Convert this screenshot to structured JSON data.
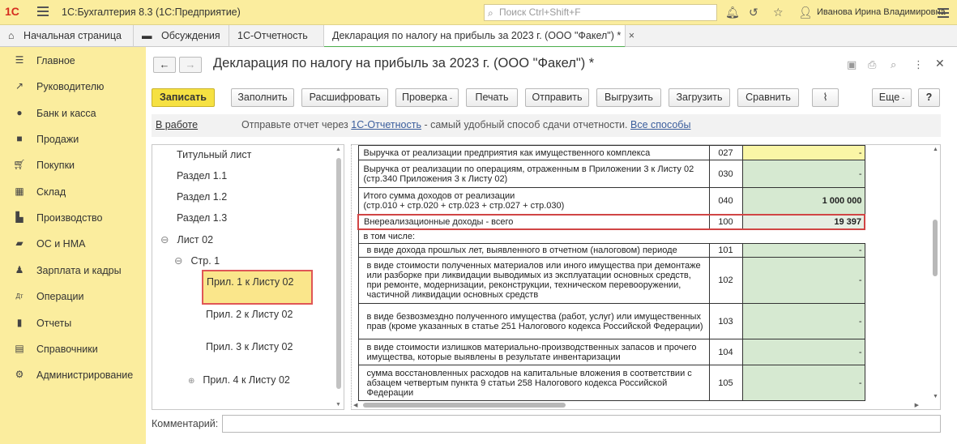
{
  "app": {
    "logo": "1С",
    "title": "1С:Бухгалтерия 8.3  (1С:Предприятие)",
    "search_placeholder": "Поиск Ctrl+Shift+F",
    "user": "Иванова Ирина Владимировна"
  },
  "tabs": [
    {
      "label": "Начальная страница",
      "icon": "home-icon"
    },
    {
      "label": "Обсуждения",
      "icon": "chat-icon"
    },
    {
      "label": "1С-Отчетность"
    },
    {
      "label": "Декларация по налогу на прибыль за 2023 г. (ООО \"Факел\") *",
      "close": "×"
    }
  ],
  "sidebar": [
    {
      "label": "Главное",
      "icon": "menu-icon"
    },
    {
      "label": "Руководителю",
      "icon": "chart-line-icon"
    },
    {
      "label": "Банк и касса",
      "icon": "coin-icon"
    },
    {
      "label": "Продажи",
      "icon": "bag-icon"
    },
    {
      "label": "Покупки",
      "icon": "cart-icon"
    },
    {
      "label": "Склад",
      "icon": "warehouse-icon"
    },
    {
      "label": "Производство",
      "icon": "factory-icon"
    },
    {
      "label": "ОС и НМА",
      "icon": "truck-icon"
    },
    {
      "label": "Зарплата и кадры",
      "icon": "person-icon"
    },
    {
      "label": "Операции",
      "icon": "debit-credit-icon"
    },
    {
      "label": "Отчеты",
      "icon": "bar-chart-icon"
    },
    {
      "label": "Справочники",
      "icon": "book-icon"
    },
    {
      "label": "Администрирование",
      "icon": "gear-icon"
    }
  ],
  "document": {
    "title": "Декларация по налогу на прибыль за 2023 г. (ООО \"Факел\") *"
  },
  "toolbar": {
    "save": "Записать",
    "fill": "Заполнить",
    "decode": "Расшифровать",
    "check": "Проверка",
    "print": "Печать",
    "send": "Отправить",
    "export": "Выгрузить",
    "import": "Загрузить",
    "compare": "Сравнить",
    "more": "Еще",
    "help": "?"
  },
  "infobar": {
    "status": "В работе",
    "msg_before": "Отправьте отчет через ",
    "msg_link": "1С-Отчетность",
    "msg_after": " - самый удобный способ сдачи отчетности. ",
    "all_ways": "Все способы"
  },
  "tree": [
    {
      "label": "Титульный лист"
    },
    {
      "label": "Раздел 1.1"
    },
    {
      "label": "Раздел 1.2"
    },
    {
      "label": "Раздел 1.3"
    },
    {
      "label": "Лист 02",
      "toggle": "⊖"
    },
    {
      "label": "Стр. 1",
      "toggle": "⊖"
    },
    {
      "label": "Прил. 1 к Листу 02",
      "selected": true
    },
    {
      "label": "Прил. 2 к Листу 02"
    },
    {
      "label": "Прил. 3 к Листу 02"
    },
    {
      "label": "Прил. 4 к Листу 02",
      "toggle": "⊕"
    }
  ],
  "report_rows": [
    {
      "text": "Выручка от реализации предприятия как имущественного комплекса",
      "code": "027",
      "value": "-",
      "style": "yellow"
    },
    {
      "text": "Выручка от реализации по операциям, отраженным в Приложении 3 к Листу 02 (стр.340 Приложения 3 к Листу 02)",
      "code": "030",
      "value": "-",
      "style": "dash"
    },
    {
      "text": "Итого сумма доходов от реализации\n(стр.010 + стр.020 + стр.023 + стр.027 + стр.030)",
      "code": "040",
      "value": "1 000 000",
      "style": "bold"
    },
    {
      "text": "Внереализационные доходы - всего",
      "code": "100",
      "value": "19 397",
      "style": "highlight"
    },
    {
      "text": "в том числе:",
      "code": "",
      "value": "",
      "style": "sub"
    },
    {
      "text": "в виде дохода прошлых лет, выявленного в отчетном (налоговом) периоде",
      "code": "101",
      "value": "-",
      "style": "dash"
    },
    {
      "text": "в виде стоимости полученных материалов или иного имущества при демонтаже или разборке при ликвидации выводимых из эксплуатации основных средств, при ремонте, модернизации, реконструкции, техническом перевооружении, частичной ликвидации основных средств",
      "code": "102",
      "value": "-",
      "style": "dash"
    },
    {
      "text": "в виде безвозмездно полученного имущества (работ, услуг) или имущественных прав (кроме указанных в статье 251 Налогового кодекса Российской Федерации)",
      "code": "103",
      "value": "-",
      "style": "dash"
    },
    {
      "text": "в виде стоимости излишков материально-производственных запасов и прочего имущества, которые выявлены в результате инвентаризации",
      "code": "104",
      "value": "-",
      "style": "dash"
    },
    {
      "text": "сумма восстановленных расходов на капитальные вложения в соответствии с абзацем четвертым пункта 9 статьи 258 Налогового кодекса Российской Федерации",
      "code": "105",
      "value": "-",
      "style": "dash"
    }
  ],
  "comment": {
    "label": "Комментарий:",
    "value": ""
  }
}
